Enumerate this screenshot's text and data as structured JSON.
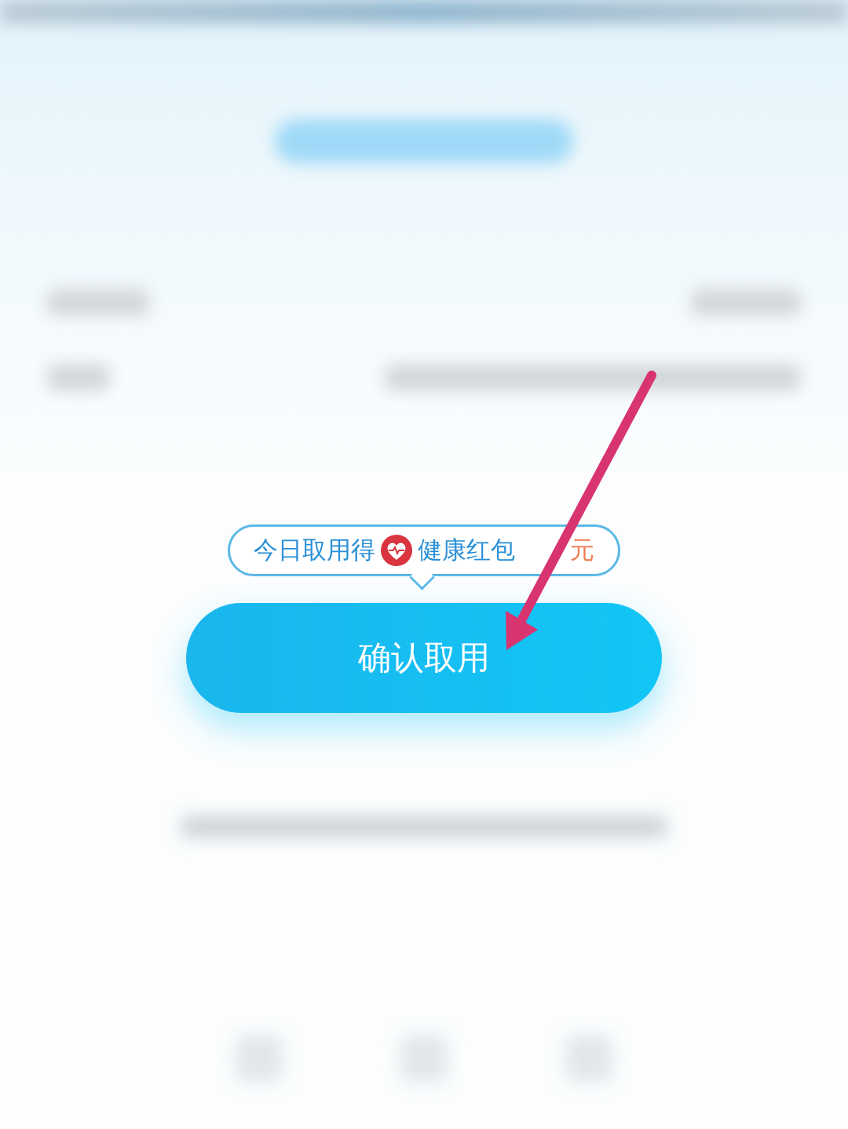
{
  "tooltip": {
    "prefix": "今日取用得",
    "label": "健康红包",
    "amount": "元"
  },
  "confirm_button": {
    "label": "确认取用"
  }
}
